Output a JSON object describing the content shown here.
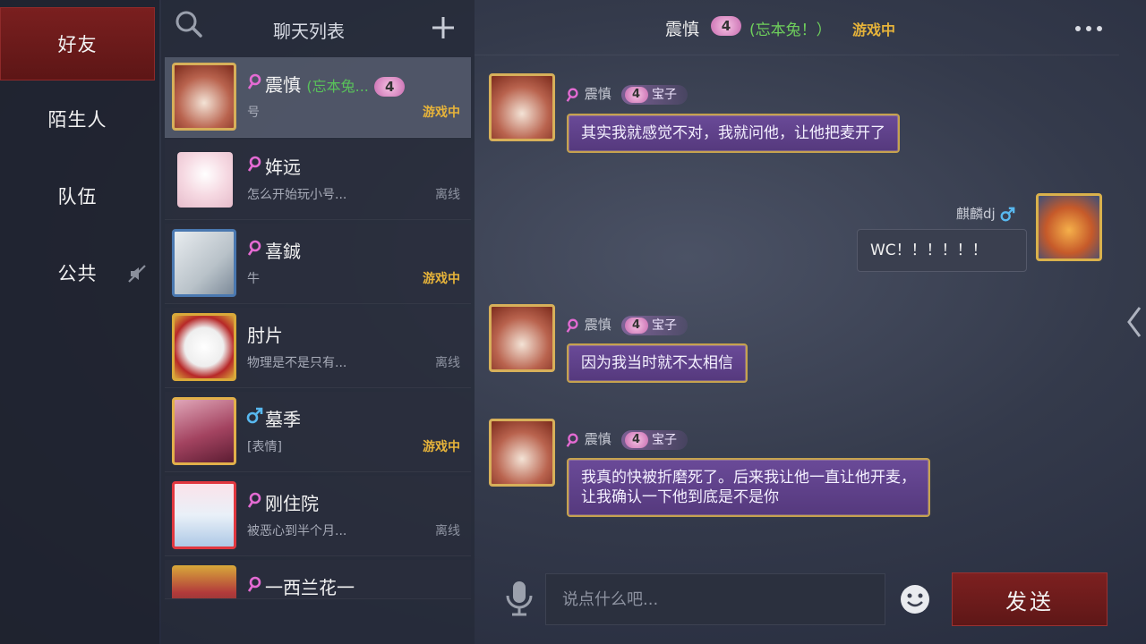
{
  "tabs": [
    {
      "label": "好友",
      "active": true
    },
    {
      "label": "陌生人",
      "active": false
    },
    {
      "label": "队伍",
      "active": false
    },
    {
      "label": "公共",
      "active": false,
      "muted": true
    }
  ],
  "list": {
    "title": "聊天列表",
    "contacts": [
      {
        "name": "震慎",
        "remark": "(忘本兔...",
        "level": "4",
        "sub": "号",
        "status": "游戏中",
        "gender": "female",
        "selected": true
      },
      {
        "name": "姩远",
        "sub": "怎么开始玩小号...",
        "status": "离线",
        "gender": "female"
      },
      {
        "name": "喜鋮",
        "sub": "牛",
        "status": "游戏中",
        "gender": "female"
      },
      {
        "name": "肘片",
        "sub": "物理是不是只有...",
        "status": "离线",
        "gender": "none"
      },
      {
        "name": "墓季",
        "sub": "[表情]",
        "status": "游戏中",
        "gender": "male"
      },
      {
        "name": "刚住院",
        "sub": "被恶心到半个月...",
        "status": "离线",
        "gender": "female"
      },
      {
        "name": "一西兰花一",
        "sub": "",
        "status": "",
        "gender": "female"
      }
    ]
  },
  "chat": {
    "header": {
      "name": "震慎",
      "level": "4",
      "remark": "(忘本兔！）",
      "status": "游戏中"
    },
    "messages": [
      {
        "sender": "震慎",
        "level": "4",
        "tag": "宝子",
        "text": "其实我就感觉不对，我就问他，让他把麦开了",
        "mine": false
      },
      {
        "sender": "麒麟dj",
        "text": "WC！！！！！！",
        "mine": true
      },
      {
        "sender": "震慎",
        "level": "4",
        "tag": "宝子",
        "text": "因为我当时就不太相信",
        "mine": false
      },
      {
        "sender": "震慎",
        "level": "4",
        "tag": "宝子",
        "text_line1": "我真的快被折磨死了。后来我让他一直让他开麦，",
        "text_line2": "让我确认一下他到底是不是你",
        "mine": false
      }
    ],
    "input_placeholder": "说点什么吧...",
    "send_label": "发送"
  },
  "colors": {
    "accent_red": "#7a1f1f",
    "ingame": "#e6b33a",
    "remark_green": "#59c25a",
    "bubble_purple": "#6a4a98",
    "bubble_border": "#c6a24f"
  },
  "icons": [
    "search-icon",
    "plus-icon",
    "more-icon",
    "mute-icon",
    "mic-icon",
    "emoji-icon",
    "chevron-left-icon",
    "female-icon",
    "male-icon"
  ]
}
